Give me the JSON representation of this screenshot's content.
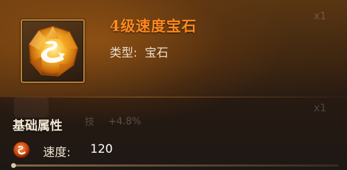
{
  "item": {
    "name": "4级速度宝石",
    "type_label": "类型:",
    "type_value": "宝石",
    "icon": "gem-speed-icon"
  },
  "background": {
    "count_top": "x1",
    "count_bottom": "x1",
    "ghost_stat_label": "技",
    "ghost_stat_value": "+4.8%"
  },
  "attributes": {
    "section_title": "基础属性",
    "stats": [
      {
        "label": "速度:",
        "value": "120",
        "icon": "speed-rune-icon"
      }
    ]
  },
  "colors": {
    "name": "#ff8a1e",
    "frame": "#b7833c",
    "gem": "#f5a41c"
  }
}
